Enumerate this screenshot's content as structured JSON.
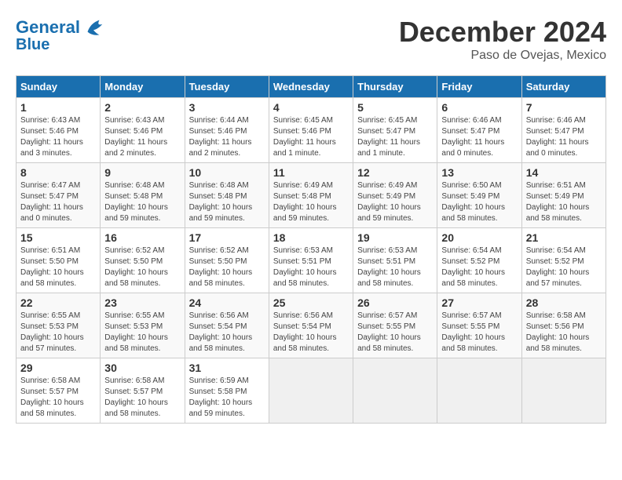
{
  "header": {
    "logo_line1": "General",
    "logo_line2": "Blue",
    "month": "December 2024",
    "location": "Paso de Ovejas, Mexico"
  },
  "weekdays": [
    "Sunday",
    "Monday",
    "Tuesday",
    "Wednesday",
    "Thursday",
    "Friday",
    "Saturday"
  ],
  "weeks": [
    [
      {
        "day": "1",
        "sunrise": "6:43 AM",
        "sunset": "5:46 PM",
        "daylight": "11 hours and 3 minutes."
      },
      {
        "day": "2",
        "sunrise": "6:43 AM",
        "sunset": "5:46 PM",
        "daylight": "11 hours and 2 minutes."
      },
      {
        "day": "3",
        "sunrise": "6:44 AM",
        "sunset": "5:46 PM",
        "daylight": "11 hours and 2 minutes."
      },
      {
        "day": "4",
        "sunrise": "6:45 AM",
        "sunset": "5:46 PM",
        "daylight": "11 hours and 1 minute."
      },
      {
        "day": "5",
        "sunrise": "6:45 AM",
        "sunset": "5:47 PM",
        "daylight": "11 hours and 1 minute."
      },
      {
        "day": "6",
        "sunrise": "6:46 AM",
        "sunset": "5:47 PM",
        "daylight": "11 hours and 0 minutes."
      },
      {
        "day": "7",
        "sunrise": "6:46 AM",
        "sunset": "5:47 PM",
        "daylight": "11 hours and 0 minutes."
      }
    ],
    [
      {
        "day": "8",
        "sunrise": "6:47 AM",
        "sunset": "5:47 PM",
        "daylight": "11 hours and 0 minutes."
      },
      {
        "day": "9",
        "sunrise": "6:48 AM",
        "sunset": "5:48 PM",
        "daylight": "10 hours and 59 minutes."
      },
      {
        "day": "10",
        "sunrise": "6:48 AM",
        "sunset": "5:48 PM",
        "daylight": "10 hours and 59 minutes."
      },
      {
        "day": "11",
        "sunrise": "6:49 AM",
        "sunset": "5:48 PM",
        "daylight": "10 hours and 59 minutes."
      },
      {
        "day": "12",
        "sunrise": "6:49 AM",
        "sunset": "5:49 PM",
        "daylight": "10 hours and 59 minutes."
      },
      {
        "day": "13",
        "sunrise": "6:50 AM",
        "sunset": "5:49 PM",
        "daylight": "10 hours and 58 minutes."
      },
      {
        "day": "14",
        "sunrise": "6:51 AM",
        "sunset": "5:49 PM",
        "daylight": "10 hours and 58 minutes."
      }
    ],
    [
      {
        "day": "15",
        "sunrise": "6:51 AM",
        "sunset": "5:50 PM",
        "daylight": "10 hours and 58 minutes."
      },
      {
        "day": "16",
        "sunrise": "6:52 AM",
        "sunset": "5:50 PM",
        "daylight": "10 hours and 58 minutes."
      },
      {
        "day": "17",
        "sunrise": "6:52 AM",
        "sunset": "5:50 PM",
        "daylight": "10 hours and 58 minutes."
      },
      {
        "day": "18",
        "sunrise": "6:53 AM",
        "sunset": "5:51 PM",
        "daylight": "10 hours and 58 minutes."
      },
      {
        "day": "19",
        "sunrise": "6:53 AM",
        "sunset": "5:51 PM",
        "daylight": "10 hours and 58 minutes."
      },
      {
        "day": "20",
        "sunrise": "6:54 AM",
        "sunset": "5:52 PM",
        "daylight": "10 hours and 58 minutes."
      },
      {
        "day": "21",
        "sunrise": "6:54 AM",
        "sunset": "5:52 PM",
        "daylight": "10 hours and 57 minutes."
      }
    ],
    [
      {
        "day": "22",
        "sunrise": "6:55 AM",
        "sunset": "5:53 PM",
        "daylight": "10 hours and 57 minutes."
      },
      {
        "day": "23",
        "sunrise": "6:55 AM",
        "sunset": "5:53 PM",
        "daylight": "10 hours and 58 minutes."
      },
      {
        "day": "24",
        "sunrise": "6:56 AM",
        "sunset": "5:54 PM",
        "daylight": "10 hours and 58 minutes."
      },
      {
        "day": "25",
        "sunrise": "6:56 AM",
        "sunset": "5:54 PM",
        "daylight": "10 hours and 58 minutes."
      },
      {
        "day": "26",
        "sunrise": "6:57 AM",
        "sunset": "5:55 PM",
        "daylight": "10 hours and 58 minutes."
      },
      {
        "day": "27",
        "sunrise": "6:57 AM",
        "sunset": "5:55 PM",
        "daylight": "10 hours and 58 minutes."
      },
      {
        "day": "28",
        "sunrise": "6:58 AM",
        "sunset": "5:56 PM",
        "daylight": "10 hours and 58 minutes."
      }
    ],
    [
      {
        "day": "29",
        "sunrise": "6:58 AM",
        "sunset": "5:57 PM",
        "daylight": "10 hours and 58 minutes."
      },
      {
        "day": "30",
        "sunrise": "6:58 AM",
        "sunset": "5:57 PM",
        "daylight": "10 hours and 58 minutes."
      },
      {
        "day": "31",
        "sunrise": "6:59 AM",
        "sunset": "5:58 PM",
        "daylight": "10 hours and 59 minutes."
      },
      null,
      null,
      null,
      null
    ]
  ]
}
